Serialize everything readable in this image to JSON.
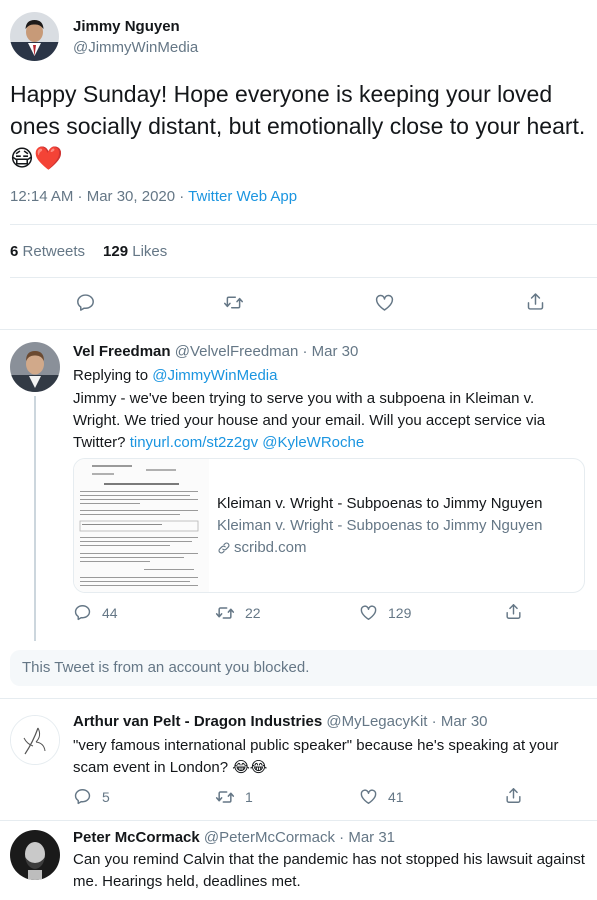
{
  "main_tweet": {
    "author_name": "Jimmy Nguyen",
    "author_handle": "@JimmyWinMedia",
    "text": "Happy Sunday!  Hope everyone is keeping your loved ones socially distant, but emotionally close to your heart.",
    "emojis": "😷❤️",
    "timestamp": "12:14 AM · Mar 30, 2020 ·",
    "source": "Twitter Web App",
    "retweets_count": "6",
    "retweets_label": "Retweets",
    "likes_count": "129",
    "likes_label": "Likes"
  },
  "replies": [
    {
      "author_name": "Vel Freedman",
      "author_handle": "@VelvelFreedman",
      "date": "· Mar 30",
      "replying_prefix": "Replying to",
      "replying_to": "@JimmyWinMedia",
      "text": "Jimmy - we've been trying to serve you with a subpoena in Kleiman v. Wright.  We tried your house and your email. Will you accept service via Twitter?",
      "link": "tinyurl.com/st2z2gv",
      "mention": "@KyleWRoche",
      "card": {
        "title": "Kleiman v. Wright - Subpoenas to Jimmy Nguyen",
        "description": "Kleiman v. Wright - Subpoenas to Jimmy Nguyen",
        "domain": "scribd.com"
      },
      "replies_count": "44",
      "retweets_count": "22",
      "likes_count": "129"
    },
    {
      "author_name": "Arthur van Pelt - Dragon Industries",
      "author_handle": "@MyLegacyKit",
      "date": "· Mar 30",
      "text": "\"very famous international public speaker\" because he's speaking at your scam event in London? 😂😂",
      "replies_count": "5",
      "retweets_count": "1",
      "likes_count": "41"
    },
    {
      "author_name": "Peter McCormack",
      "author_handle": "@PeterMcCormack",
      "date": "· Mar 31",
      "text": "Can you remind Calvin that the pandemic has not stopped his lawsuit against me. Hearings held, deadlines met."
    }
  ],
  "blocked_notice": "This Tweet is from an account you blocked.",
  "icons": {
    "reply": "reply-icon",
    "retweet": "retweet-icon",
    "like": "like-icon",
    "share": "share-icon",
    "link": "link-icon"
  },
  "colors": {
    "link": "#1b95e0",
    "muted": "#657786",
    "text": "#14171a",
    "heart": "#e0245e",
    "divider": "#e6ecf0"
  }
}
